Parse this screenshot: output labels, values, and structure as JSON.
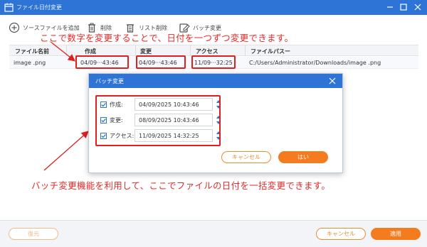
{
  "window": {
    "title": "ファイル日付変更"
  },
  "toolbar": {
    "add_source": "ソースファイルを追加",
    "delete": "削除",
    "clear_list": "リスト削除",
    "batch_change": "バッチ変更"
  },
  "table": {
    "headers": [
      "ファイル名前",
      "作成",
      "変更",
      "アクセス",
      "ファイルパスー"
    ],
    "rows": [
      {
        "name": "image .png",
        "created": "04/09···43:46",
        "modified": "04/09···43:46",
        "accessed": "11/09···32:25",
        "path": "C:/Users/Administrator/Downloads/image .png"
      }
    ]
  },
  "annotations": {
    "top": "ここで数字を変更することで、日付を一つずつ変更できます。",
    "bottom": "バッチ変更機能を利用して、ここでファイルの日付を一括変更できます。"
  },
  "dialog": {
    "title": "バッチ変更",
    "rows": [
      {
        "label": "作成:",
        "value": "04/09/2025 10:43:46",
        "checked": true
      },
      {
        "label": "変更:",
        "value": "08/09/2025 10:43:46",
        "checked": true
      },
      {
        "label": "アクセス:",
        "value": "11/09/2025 14:32:25",
        "checked": true
      }
    ],
    "cancel": "キャンセル",
    "ok": "はい"
  },
  "footer": {
    "restore": "復元",
    "cancel": "キャンセル",
    "apply": "適用"
  },
  "colors": {
    "titlebar": "#2d74d6",
    "accent_orange": "#f57b1f",
    "annotation_red": "#e02020"
  }
}
